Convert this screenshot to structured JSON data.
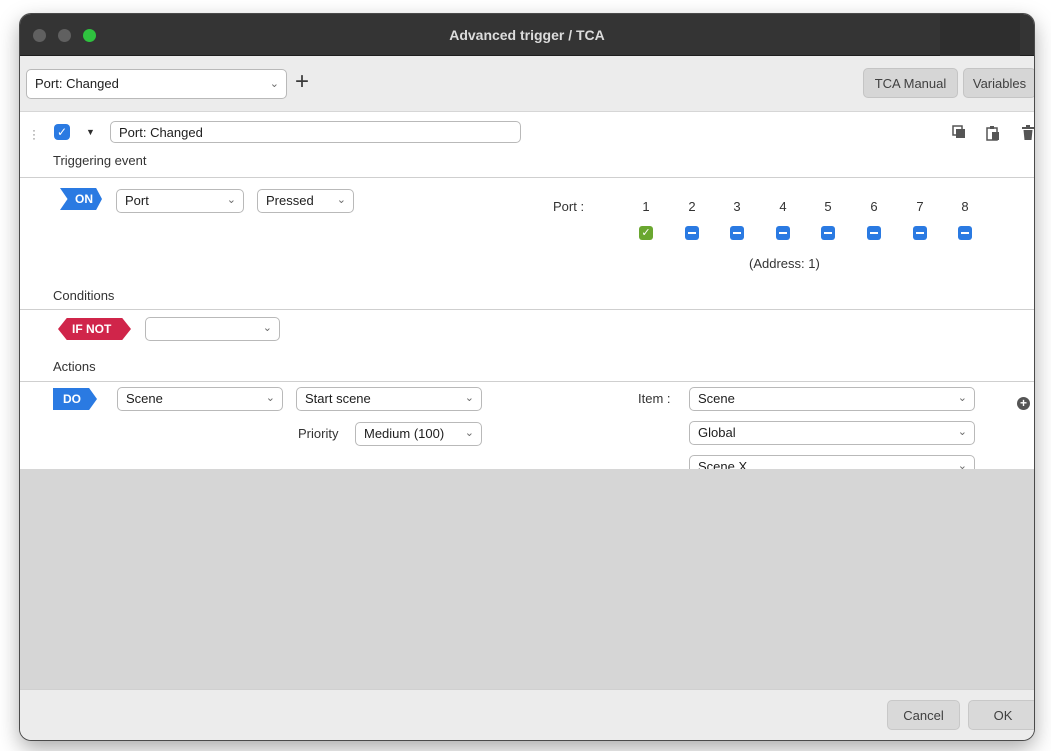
{
  "window": {
    "title": "Advanced trigger / TCA"
  },
  "toolbar": {
    "trigger_select": "Port: Changed",
    "add_label": "+",
    "tca_manual_label": "TCA Manual",
    "variables_label": "Variables"
  },
  "rule": {
    "enabled": true,
    "name": "Port: Changed",
    "icons": [
      "drag-handle-icon",
      "checkbox-icon",
      "collapse-caret-icon",
      "copy-icon",
      "paste-icon",
      "trash-icon"
    ]
  },
  "triggering": {
    "section_label": "Triggering event",
    "pill": "ON",
    "source": "Port",
    "event": "Pressed",
    "port_label": "Port :",
    "ports": [
      {
        "number": "1",
        "state": "checked"
      },
      {
        "number": "2",
        "state": "indeterminate"
      },
      {
        "number": "3",
        "state": "indeterminate"
      },
      {
        "number": "4",
        "state": "indeterminate"
      },
      {
        "number": "5",
        "state": "indeterminate"
      },
      {
        "number": "6",
        "state": "indeterminate"
      },
      {
        "number": "7",
        "state": "indeterminate"
      },
      {
        "number": "8",
        "state": "indeterminate"
      }
    ],
    "address": "(Address: 1)"
  },
  "conditions": {
    "section_label": "Conditions",
    "pill": "IF NOT",
    "value": ""
  },
  "actions": {
    "section_label": "Actions",
    "pill": "DO",
    "type": "Scene",
    "command": "Start scene",
    "priority_label": "Priority",
    "priority": "Medium (100)",
    "item_label": "Item :",
    "item_1": "Scene",
    "item_2": "Global",
    "item_3": "Scene X"
  },
  "footer": {
    "cancel_label": "Cancel",
    "ok_label": "OK"
  },
  "colors": {
    "accent_blue": "#2a7ae2",
    "if_not_red": "#d0254a",
    "checked_green": "#6aa730",
    "maximize_green": "#2fc23f"
  }
}
